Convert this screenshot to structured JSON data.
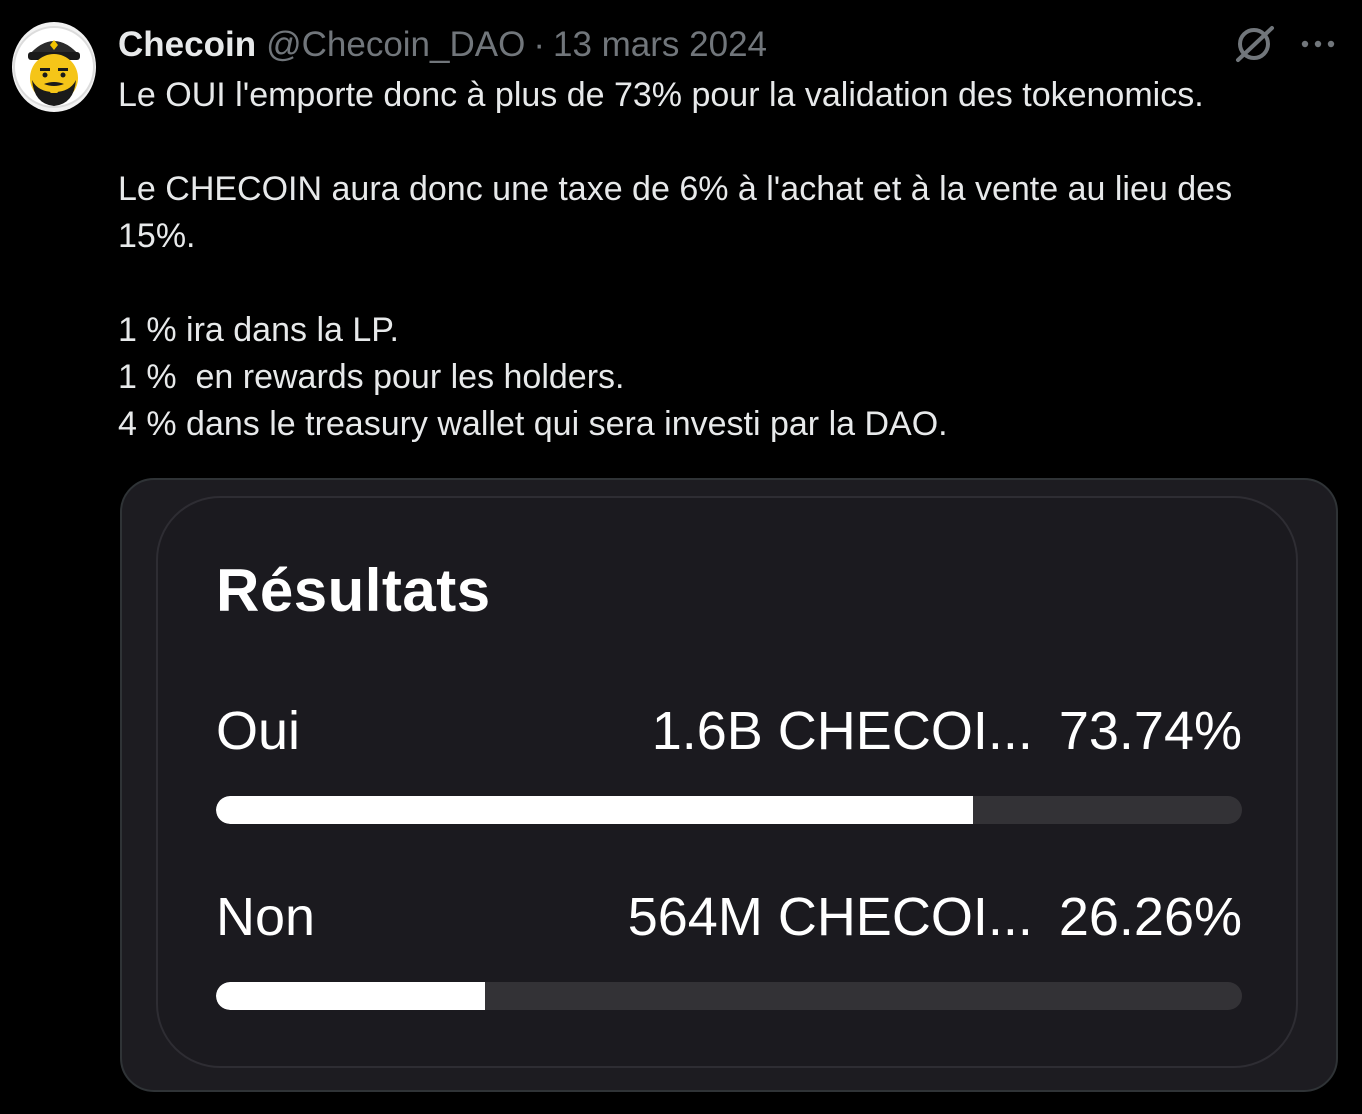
{
  "tweet": {
    "display_name": "Checoin",
    "handle": "@Checoin_DAO",
    "separator": "·",
    "date": "13 mars 2024",
    "lines": [
      "Le OUI l'emporte donc à plus de 73% pour la validation des tokenomics.",
      "Le CHECOIN aura donc une taxe de 6% à l'achat et à la vente au lieu des 15%.",
      "1 % ira dans la LP.",
      "1 %  en rewards pour les holders.",
      "4 % dans le treasury wallet qui sera investi par la DAO."
    ]
  },
  "icons": {
    "avatar": "bearded-man-avatar",
    "grok": "grok-slash-icon",
    "more": "more-dots-icon"
  },
  "poll": {
    "title": "Résultats",
    "options": [
      {
        "label": "Oui",
        "amount": "1.6B CHECOI...",
        "percent": "73.74%",
        "fraction": 0.7374
      },
      {
        "label": "Non",
        "amount": "564M CHECOI...",
        "percent": "26.26%",
        "fraction": 0.2626
      }
    ]
  },
  "colors": {
    "background": "#000000",
    "text": "#e7e9ea",
    "muted": "#71767b",
    "bar_fill": "#ffffff",
    "bar_track": "#333236"
  }
}
